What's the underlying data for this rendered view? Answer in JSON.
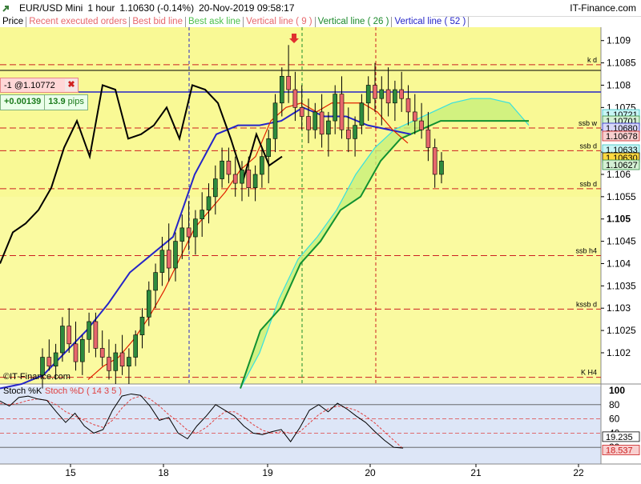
{
  "header": {
    "symbol": "EUR/USD Mini",
    "timeframe": "1 hour",
    "quote": "1.10630 (-0.14%)",
    "timestamp": "20-Nov-2019 09:58:17",
    "brand": "IT-Finance.com"
  },
  "legend": {
    "price": "Price",
    "recent": "Recent executed orders",
    "bid": "Best bid line",
    "ask": "Best ask line",
    "v9": "Vertical line ( 9 )",
    "v26": "Vertical line ( 26 )",
    "v52": "Vertical line ( 52 )"
  },
  "position": {
    "label": "-1 @1.10772",
    "pnl": "+0.00139",
    "pips_value": "13.9",
    "pips_unit": "pips"
  },
  "watermark": "©IT-Finance.com",
  "colors": {
    "bull": "#2e8b3e",
    "bear": "#e7676c",
    "tenkan": "#e02000",
    "kijun": "#2525c8",
    "chikou": "#000000",
    "spanA": "#38e0e0",
    "spanB": "#109030",
    "cloud": "#c8f07a"
  },
  "chart_data": [
    {
      "type": "candlestick",
      "y_ticks": [
        "1.109",
        "1.1085",
        "1.108",
        "1.1075",
        "1.107",
        "1.1065",
        "1.106",
        "1.1055",
        "1.105",
        "1.1045",
        "1.104",
        "1.1035",
        "1.103",
        "1.1025",
        "1.102"
      ],
      "x_ticks": [
        "15",
        "18",
        "19",
        "20",
        "21",
        "22"
      ],
      "levels": [
        {
          "label": "k d",
          "value": 1.10846
        },
        {
          "label": "ssb w",
          "value": 1.10704
        },
        {
          "label": "ssb d",
          "value": 1.10653
        },
        {
          "label": "ssb d",
          "value": 1.10568
        },
        {
          "label": "ssb h4",
          "value": 1.10418
        },
        {
          "label": "kssb d",
          "value": 1.10298
        },
        {
          "label": "K H4",
          "value": 1.10145
        }
      ],
      "price_tags": [
        {
          "label": "1.10721",
          "kind": "cyan"
        },
        {
          "label": "1.10701",
          "kind": "green"
        },
        {
          "label": "1.10680",
          "kind": "blue"
        },
        {
          "label": "1.10678",
          "kind": "red"
        },
        {
          "label": "1.10633",
          "kind": "cyan"
        },
        {
          "label": "1.10630",
          "kind": "current"
        },
        {
          "label": "1.10627",
          "kind": "green"
        }
      ],
      "candles": [
        [
          1.1015,
          1.1021,
          1.1012,
          1.1019
        ],
        [
          1.1019,
          1.1023,
          1.1016,
          1.1017
        ],
        [
          1.1017,
          1.1022,
          1.1014,
          1.102
        ],
        [
          1.102,
          1.1028,
          1.1018,
          1.1026
        ],
        [
          1.1026,
          1.103,
          1.102,
          1.1022
        ],
        [
          1.1022,
          1.1027,
          1.1016,
          1.1018
        ],
        [
          1.1018,
          1.1024,
          1.1015,
          1.1023
        ],
        [
          1.1023,
          1.1029,
          1.102,
          1.1027
        ],
        [
          1.1027,
          1.1029,
          1.1019,
          1.1021
        ],
        [
          1.1021,
          1.1025,
          1.1017,
          1.1019
        ],
        [
          1.1019,
          1.1023,
          1.1014,
          1.1016
        ],
        [
          1.1016,
          1.1022,
          1.1013,
          1.102
        ],
        [
          1.102,
          1.1024,
          1.1015,
          1.1017
        ],
        [
          1.1017,
          1.1021,
          1.1013,
          1.1019
        ],
        [
          1.1019,
          1.1025,
          1.1017,
          1.1024
        ],
        [
          1.1024,
          1.103,
          1.1021,
          1.1028
        ],
        [
          1.1028,
          1.1036,
          1.1026,
          1.1034
        ],
        [
          1.1034,
          1.104,
          1.103,
          1.1038
        ],
        [
          1.1038,
          1.1046,
          1.1035,
          1.1043
        ],
        [
          1.1043,
          1.1049,
          1.1036,
          1.1039
        ],
        [
          1.1039,
          1.1047,
          1.1036,
          1.1045
        ],
        [
          1.1045,
          1.1051,
          1.1041,
          1.1048
        ],
        [
          1.1048,
          1.1054,
          1.1043,
          1.1046
        ],
        [
          1.1046,
          1.1052,
          1.1042,
          1.105
        ],
        [
          1.105,
          1.1056,
          1.1046,
          1.1052
        ],
        [
          1.1052,
          1.1058,
          1.1049,
          1.1055
        ],
        [
          1.1055,
          1.1062,
          1.1051,
          1.1059
        ],
        [
          1.1059,
          1.1066,
          1.1057,
          1.1063
        ],
        [
          1.1063,
          1.1066,
          1.1058,
          1.106
        ],
        [
          1.106,
          1.1064,
          1.1055,
          1.1058
        ],
        [
          1.1058,
          1.1063,
          1.1054,
          1.1061
        ],
        [
          1.1061,
          1.1064,
          1.1055,
          1.1057
        ],
        [
          1.1057,
          1.1062,
          1.1054,
          1.106
        ],
        [
          1.106,
          1.1066,
          1.1057,
          1.1064
        ],
        [
          1.1064,
          1.107,
          1.1058,
          1.1068
        ],
        [
          1.1068,
          1.1078,
          1.1065,
          1.1076
        ],
        [
          1.1076,
          1.1084,
          1.1073,
          1.1082
        ],
        [
          1.1082,
          1.1089,
          1.1076,
          1.1079
        ],
        [
          1.1079,
          1.1083,
          1.1072,
          1.1075
        ],
        [
          1.1075,
          1.108,
          1.107,
          1.1073
        ],
        [
          1.1073,
          1.1077,
          1.1067,
          1.107
        ],
        [
          1.107,
          1.1076,
          1.1068,
          1.1074
        ],
        [
          1.1074,
          1.1078,
          1.1066,
          1.1069
        ],
        [
          1.1069,
          1.1074,
          1.1064,
          1.1072
        ],
        [
          1.1072,
          1.108,
          1.1069,
          1.1078
        ],
        [
          1.1078,
          1.1082,
          1.1068,
          1.107
        ],
        [
          1.107,
          1.1075,
          1.1065,
          1.1068
        ],
        [
          1.1068,
          1.1073,
          1.1064,
          1.1071
        ],
        [
          1.1071,
          1.1078,
          1.1069,
          1.1076
        ],
        [
          1.1076,
          1.1082,
          1.1072,
          1.108
        ],
        [
          1.108,
          1.1085,
          1.1074,
          1.1077
        ],
        [
          1.1077,
          1.1082,
          1.1071,
          1.1079
        ],
        [
          1.1079,
          1.1084,
          1.1073,
          1.1076
        ],
        [
          1.1076,
          1.1081,
          1.1072,
          1.1079
        ],
        [
          1.1079,
          1.1083,
          1.1074,
          1.1077
        ],
        [
          1.1077,
          1.108,
          1.1071,
          1.1074
        ],
        [
          1.1074,
          1.1078,
          1.1069,
          1.1072
        ],
        [
          1.1072,
          1.1076,
          1.1068,
          1.107
        ],
        [
          1.107,
          1.1074,
          1.1063,
          1.1066
        ],
        [
          1.1066,
          1.1068,
          1.1057,
          1.106
        ],
        [
          1.106,
          1.1065,
          1.1058,
          1.1063
        ]
      ],
      "tenkan": [
        1.1014,
        1.1017,
        1.1019,
        1.1023,
        1.1028,
        1.1034,
        1.1041,
        1.1048,
        1.1052,
        1.1056,
        1.1061,
        1.1064,
        1.1072,
        1.1075,
        1.1076,
        1.1074,
        1.1076,
        1.1076,
        1.1076,
        1.1074,
        1.107,
        1.1067
      ],
      "kijun": [
        1.1012,
        1.1013,
        1.1015,
        1.102,
        1.1025,
        1.1031,
        1.1038,
        1.1042,
        1.1046,
        1.106,
        1.1069,
        1.1071,
        1.1071,
        1.1072,
        1.1075,
        1.1073,
        1.1073,
        1.1071,
        1.107,
        1.1069
      ],
      "chikou": [
        1.104,
        1.1047,
        1.1049,
        1.1052,
        1.1057,
        1.1066,
        1.1072,
        1.1064,
        1.108,
        1.1079,
        1.1068,
        1.1069,
        1.1071,
        1.1075,
        1.1068,
        1.108,
        1.1079,
        1.1076,
        1.1068,
        1.1059,
        1.1069,
        1.1062,
        1.1064
      ],
      "span_a": [
        1.1012,
        1.102,
        1.1032,
        1.1041,
        1.1046,
        1.1052,
        1.106,
        1.1066,
        1.107,
        1.1072,
        1.1074,
        1.1076,
        1.1077,
        1.1077,
        1.1076,
        1.1071
      ],
      "span_b": [
        1.1012,
        1.1025,
        1.103,
        1.104,
        1.1045,
        1.1052,
        1.1055,
        1.1063,
        1.1068,
        1.107,
        1.1072
      ]
    },
    {
      "type": "line",
      "title_k": "Stoch %K",
      "title_d": "Stoch %D ( 14 3 5 )",
      "y_ticks": [
        "100",
        "80",
        "60",
        "40",
        "20"
      ],
      "ylim": [
        0,
        100
      ],
      "k_value": "19.235",
      "d_value": "18.537",
      "k": [
        85,
        78,
        90,
        92,
        88,
        86,
        70,
        55,
        68,
        50,
        40,
        45,
        72,
        92,
        95,
        93,
        78,
        58,
        62,
        40,
        32,
        50,
        64,
        80,
        72,
        64,
        50,
        40,
        38,
        42,
        45,
        28,
        48,
        72,
        80,
        70,
        82,
        74,
        64,
        55,
        42,
        30,
        20,
        19
      ],
      "d": [
        82,
        80,
        82,
        86,
        88,
        86,
        80,
        70,
        64,
        58,
        52,
        48,
        58,
        75,
        88,
        92,
        88,
        78,
        66,
        56,
        44,
        40,
        48,
        60,
        70,
        70,
        62,
        52,
        44,
        40,
        42,
        40,
        42,
        54,
        66,
        74,
        78,
        76,
        72,
        64,
        54,
        42,
        30,
        18
      ]
    }
  ]
}
